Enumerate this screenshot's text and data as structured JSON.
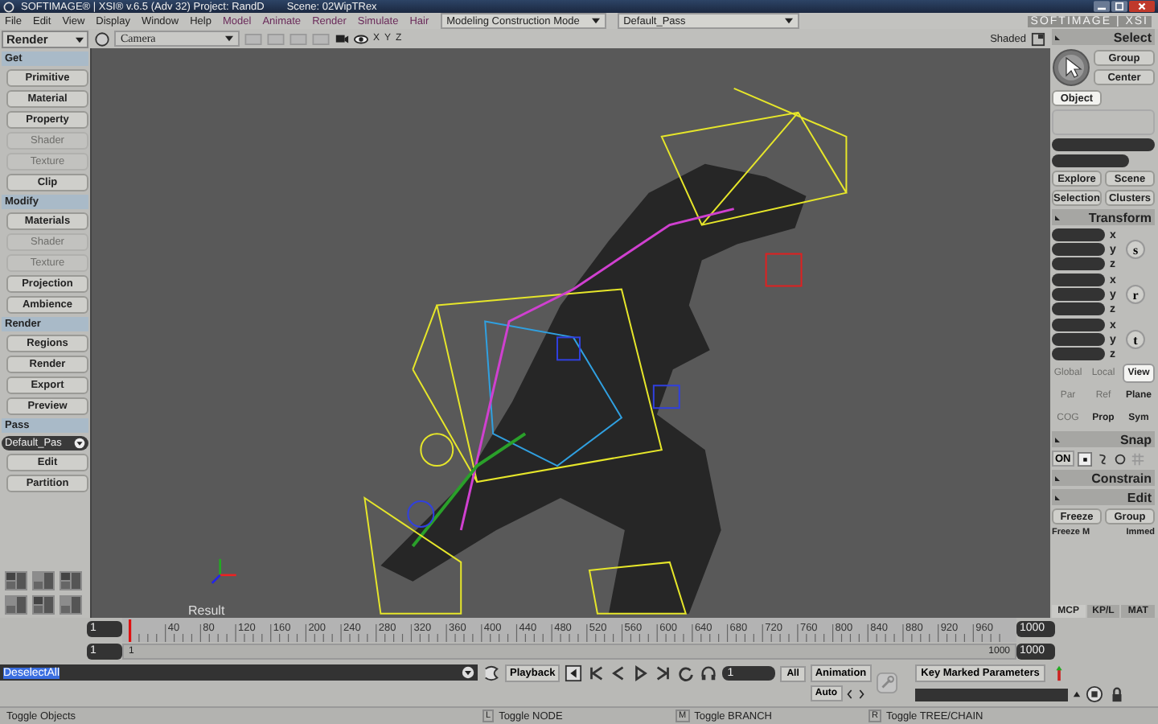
{
  "window": {
    "title": "SOFTIMAGE® | XSI® v.6.5 (Adv 32) Project: RandD",
    "scene": "Scene: 02WipTRex"
  },
  "menu_bar": [
    {
      "label": "File",
      "kind": "system"
    },
    {
      "label": "Edit",
      "kind": "system"
    },
    {
      "label": "View",
      "kind": "system"
    },
    {
      "label": "Display",
      "kind": "system"
    },
    {
      "label": "Window",
      "kind": "system"
    },
    {
      "label": "Help",
      "kind": "system"
    },
    {
      "label": "Model",
      "kind": "module"
    },
    {
      "label": "Animate",
      "kind": "module"
    },
    {
      "label": "Render",
      "kind": "module"
    },
    {
      "label": "Simulate",
      "kind": "module"
    },
    {
      "label": "Hair",
      "kind": "module"
    }
  ],
  "mode_dropdown": "Modeling Construction Mode",
  "pass_dropdown": "Default_Pass",
  "logo": "SOFTIMAGE | XSI",
  "toolbar_dropdown": "Render",
  "viewport": {
    "camera": "Camera",
    "axes": [
      "X",
      "Y",
      "Z"
    ],
    "display_mode": "Shaded",
    "label": "Result"
  },
  "left_panel": [
    {
      "title": "Get",
      "items": [
        {
          "label": "Primitive",
          "kind": "button",
          "disabled": false
        },
        {
          "label": "Material",
          "kind": "button",
          "disabled": false
        },
        {
          "label": "Property",
          "kind": "button",
          "disabled": false
        },
        {
          "label": "Shader",
          "kind": "button",
          "disabled": true
        },
        {
          "label": "Texture",
          "kind": "button",
          "disabled": true
        },
        {
          "label": "Clip",
          "kind": "button",
          "disabled": false
        }
      ]
    },
    {
      "title": "Modify",
      "items": [
        {
          "label": "Materials",
          "kind": "button",
          "disabled": false
        },
        {
          "label": "Shader",
          "kind": "button",
          "disabled": true
        },
        {
          "label": "Texture",
          "kind": "button",
          "disabled": true
        },
        {
          "label": "Projection",
          "kind": "button",
          "disabled": false
        },
        {
          "label": "Ambience",
          "kind": "button",
          "disabled": false
        }
      ]
    },
    {
      "title": "Render",
      "items": [
        {
          "label": "Regions",
          "kind": "button",
          "disabled": false
        },
        {
          "label": "Render",
          "kind": "button",
          "disabled": false
        },
        {
          "label": "Export",
          "kind": "button",
          "disabled": false
        },
        {
          "label": "Preview",
          "kind": "button",
          "disabled": false
        }
      ]
    },
    {
      "title": "Pass",
      "items": [
        {
          "label": "Default_Pas",
          "kind": "dropdown"
        },
        {
          "label": "Edit",
          "kind": "button",
          "disabled": false
        },
        {
          "label": "Partition",
          "kind": "button",
          "disabled": false
        }
      ]
    }
  ],
  "timeline": {
    "start": "1",
    "end": "1000",
    "ticks": [
      "40",
      "80",
      "120",
      "160",
      "200",
      "240",
      "280",
      "320",
      "360",
      "400",
      "440",
      "480",
      "520",
      "560",
      "600",
      "640",
      "680",
      "720",
      "760",
      "800",
      "840",
      "880",
      "920",
      "960"
    ],
    "range_start": "1",
    "range": {
      "start_label": "1",
      "end_label": "1000",
      "level": 1
    },
    "range_end": "1000"
  },
  "command_line": {
    "value": "DeselectAll"
  },
  "playback": {
    "label": "Playback",
    "frame": "1",
    "all": "All",
    "animation": "Animation",
    "auto": "Auto",
    "key_marked": "Key Marked Parameters"
  },
  "right_panel": {
    "select": {
      "title": "Select",
      "buttons": [
        "Group",
        "Center"
      ],
      "filters": [
        {
          "label": "Object",
          "selected": true
        }
      ],
      "explore": [
        "Explore",
        "Scene",
        "Selection",
        "Clusters"
      ]
    },
    "transform": {
      "title": "Transform",
      "groups": [
        {
          "key": "s",
          "axes": [
            "x",
            "y",
            "z"
          ]
        },
        {
          "key": "r",
          "axes": [
            "x",
            "y",
            "z"
          ]
        },
        {
          "key": "t",
          "axes": [
            "x",
            "y",
            "z"
          ]
        }
      ],
      "modes": [
        {
          "label": "Global",
          "disabled": true,
          "selected": false
        },
        {
          "label": "Local",
          "disabled": true,
          "selected": false
        },
        {
          "label": "View",
          "disabled": false,
          "selected": true
        },
        {
          "label": "Par",
          "disabled": true,
          "selected": false
        },
        {
          "label": "Ref",
          "disabled": true,
          "selected": false
        },
        {
          "label": "Plane",
          "disabled": false,
          "selected": false
        },
        {
          "label": "COG",
          "disabled": true,
          "selected": false
        },
        {
          "label": "Prop",
          "disabled": false,
          "selected": false
        },
        {
          "label": "Sym",
          "disabled": false,
          "selected": false
        }
      ]
    },
    "snap": {
      "title": "Snap",
      "on": "ON"
    },
    "constrain": "Constrain",
    "edit": {
      "title": "Edit",
      "buttons": [
        "Freeze",
        "Group"
      ],
      "more": [
        "Freeze M",
        "Immed"
      ]
    },
    "tabs": [
      {
        "label": "MCP",
        "selected": true
      },
      {
        "label": "KP/L",
        "selected": false
      },
      {
        "label": "MAT",
        "selected": false
      }
    ]
  },
  "status_bar": [
    {
      "text": "Toggle Objects"
    },
    {
      "key": "L",
      "text": "Toggle NODE"
    },
    {
      "key": "M",
      "text": "Toggle BRANCH"
    },
    {
      "key": "R",
      "text": "Toggle TREE/CHAIN"
    }
  ]
}
